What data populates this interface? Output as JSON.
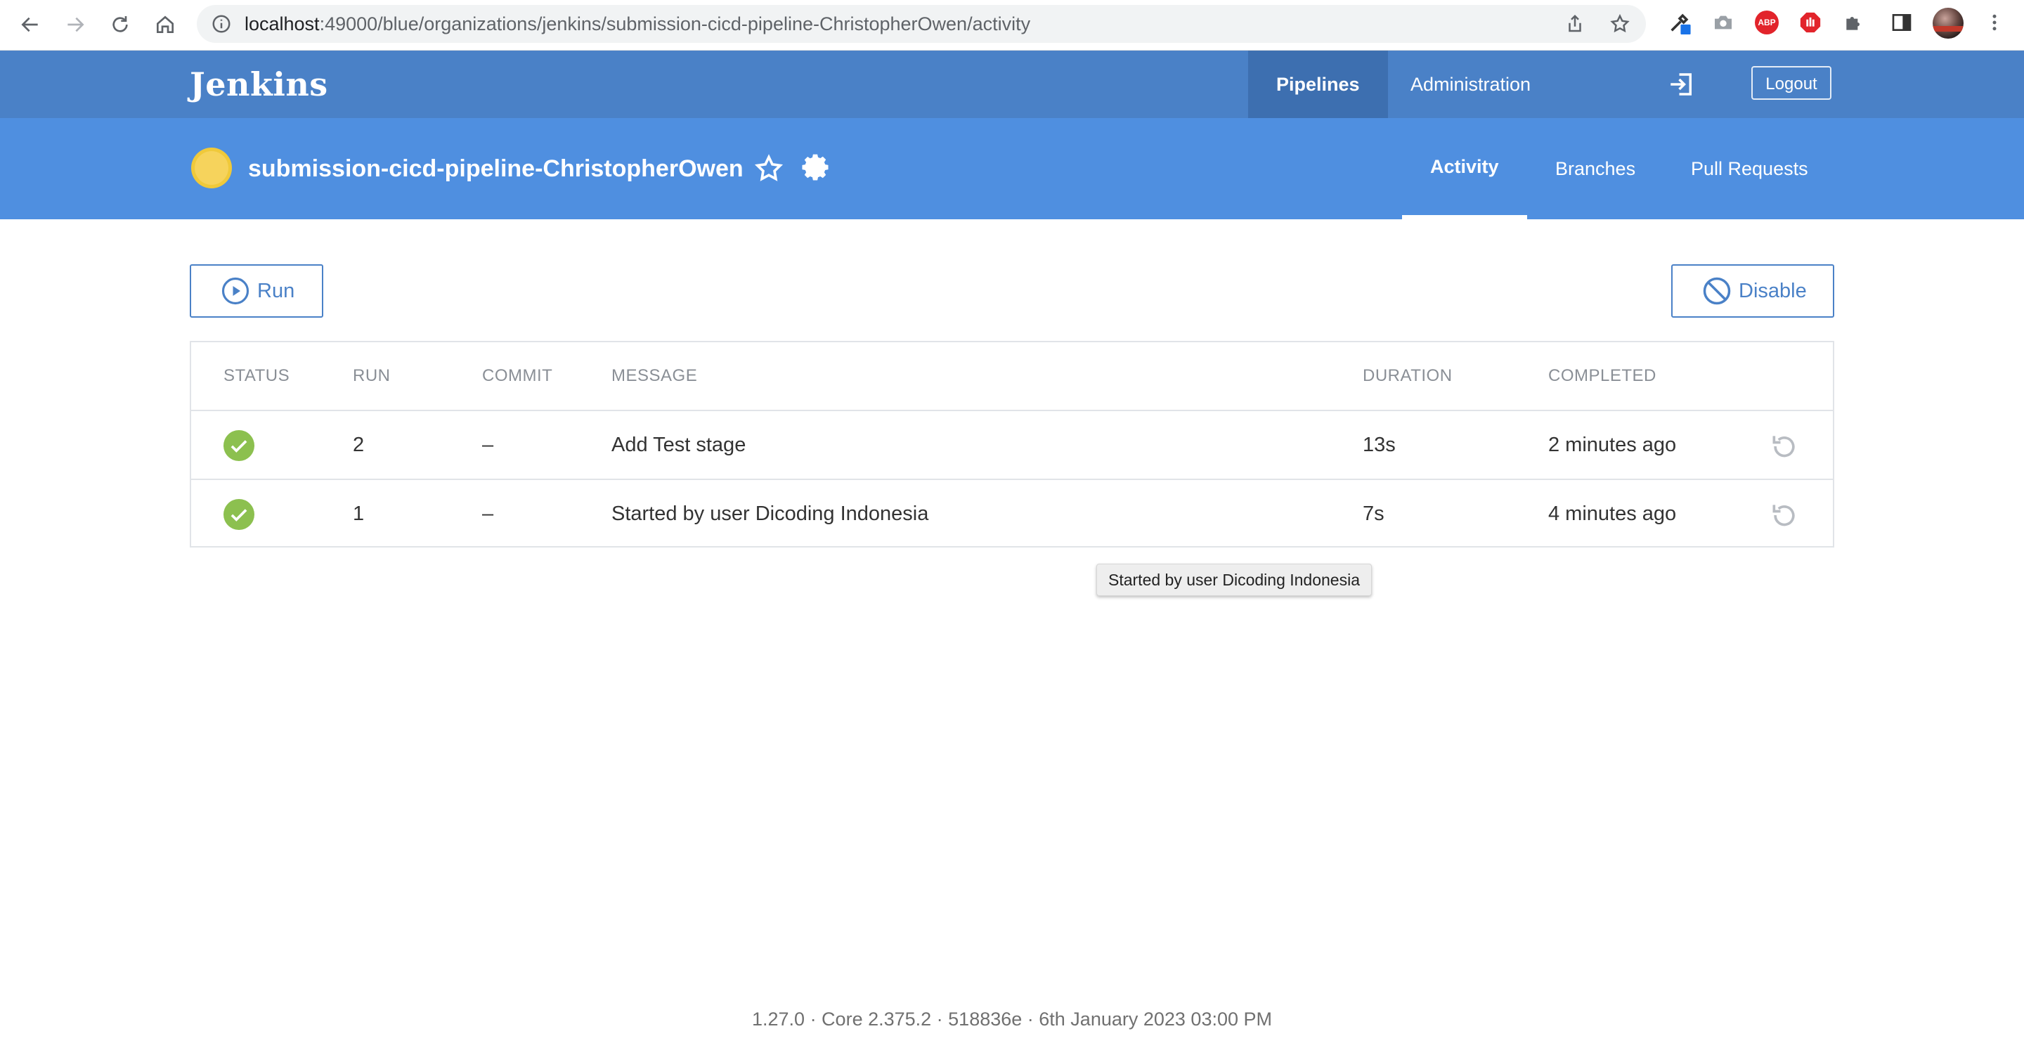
{
  "browser": {
    "url_host": "localhost",
    "url_rest": ":49000/blue/organizations/jenkins/submission-cicd-pipeline-ChristopherOwen/activity",
    "abp_label": "ABP"
  },
  "header": {
    "logo": "Jenkins",
    "nav": {
      "pipelines": "Pipelines",
      "administration": "Administration"
    },
    "logout": "Logout"
  },
  "pipeline": {
    "name": "submission-cicd-pipeline-ChristopherOwen",
    "tabs": {
      "activity": "Activity",
      "branches": "Branches",
      "pull_requests": "Pull Requests"
    }
  },
  "actions": {
    "run": "Run",
    "disable": "Disable"
  },
  "table": {
    "headers": {
      "status": "STATUS",
      "run": "RUN",
      "commit": "COMMIT",
      "message": "MESSAGE",
      "duration": "DURATION",
      "completed": "COMPLETED"
    },
    "rows": [
      {
        "status": "success",
        "run": "2",
        "commit": "–",
        "message": "Add Test stage",
        "duration": "13s",
        "completed": "2 minutes ago"
      },
      {
        "status": "success",
        "run": "1",
        "commit": "–",
        "message": "Started by user Dicoding Indonesia",
        "duration": "7s",
        "completed": "4 minutes ago"
      }
    ]
  },
  "tooltip": "Started by user Dicoding Indonesia",
  "footer": "1.27.0 · Core 2.375.2 · 518836e · 6th January 2023 03:00 PM",
  "colors": {
    "header": "#4a81c7",
    "pipeline_bar": "#4f8fe0",
    "success": "#8cc04f",
    "weather": "#f6d35c"
  }
}
